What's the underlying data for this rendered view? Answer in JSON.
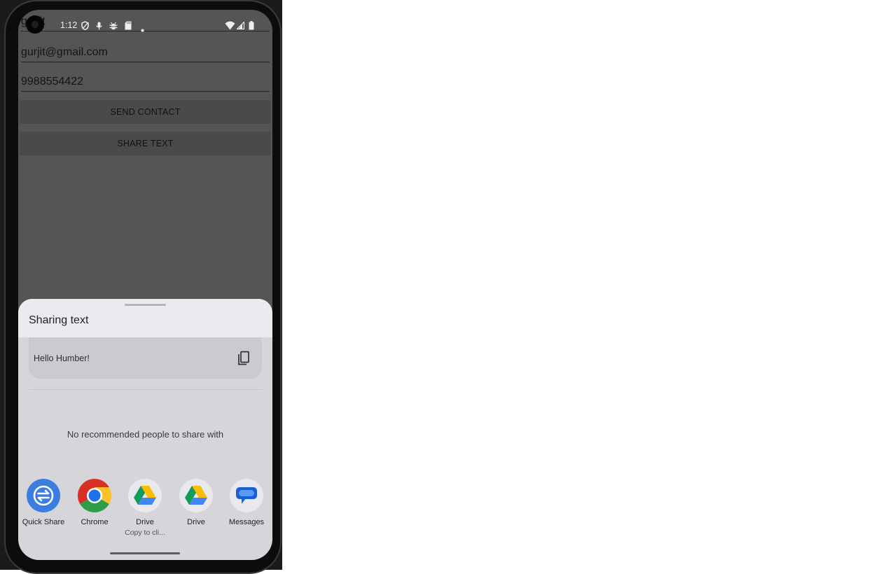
{
  "status_bar": {
    "time": "1:12",
    "icons": [
      "shield-icon",
      "mic-icon",
      "bug-icon",
      "sd-card-icon",
      "dot-icon",
      "wifi-icon",
      "signal-icon",
      "battery-icon"
    ]
  },
  "background_app": {
    "name_field_value": "gurjit",
    "email_field_value": "gurjit@gmail.com",
    "phone_field_value": "9988554422",
    "send_contact_label": "SEND CONTACT",
    "share_text_label": "SHARE TEXT"
  },
  "share_sheet": {
    "title": "Sharing text",
    "preview_text": "Hello Humber!",
    "no_people_text": "No recommended people to share with",
    "apps": [
      {
        "label": "Quick Share",
        "sub": "",
        "icon": "quick-share-icon"
      },
      {
        "label": "Chrome",
        "sub": "",
        "icon": "chrome-icon"
      },
      {
        "label": "Drive",
        "sub": "Copy to cli...",
        "icon": "drive-icon"
      },
      {
        "label": "Drive",
        "sub": "",
        "icon": "drive-icon"
      },
      {
        "label": "Messages",
        "sub": "",
        "icon": "messages-icon"
      }
    ]
  },
  "colors": {
    "scrim": "#555556",
    "sheet_background": "#d6d5da",
    "quick_share_blue": "#3c7ee0",
    "messages_blue": "#1a5fd8"
  }
}
